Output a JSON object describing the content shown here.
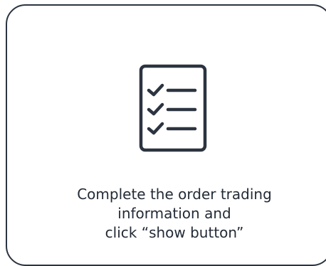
{
  "card": {
    "icon": "checklist-icon",
    "message_lines": [
      "Complete the order trading",
      "information and",
      "click “show button”"
    ]
  },
  "colors": {
    "border": "#2b3440",
    "text": "#232b36",
    "icon": "#2b3440",
    "background": "#ffffff"
  }
}
